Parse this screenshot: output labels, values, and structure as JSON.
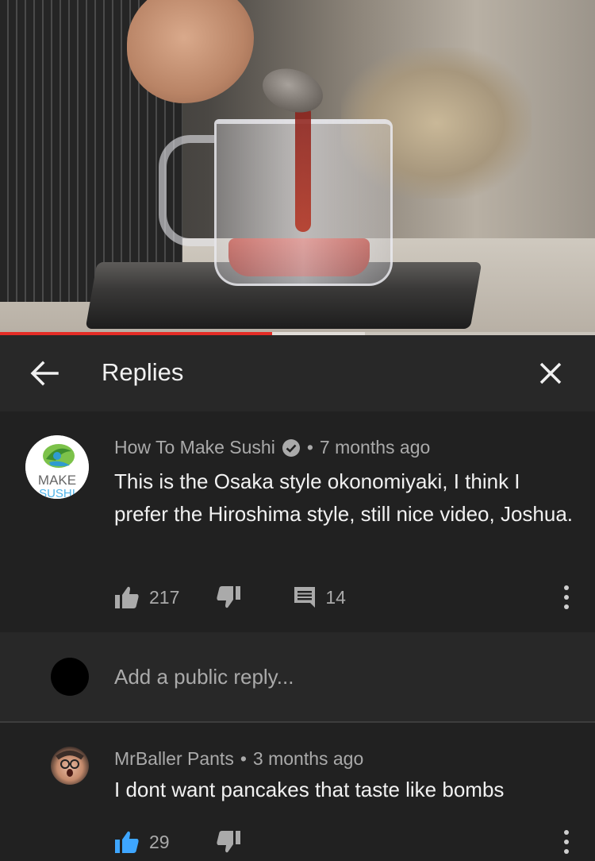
{
  "video": {
    "progress_fraction": 0.457,
    "buffered_fraction": 0.613,
    "progress_color": "#e52d27"
  },
  "header": {
    "title": "Replies",
    "back_icon": "arrow-left-icon",
    "close_icon": "close-icon"
  },
  "main_comment": {
    "author": "How To Make Sushi",
    "verified_icon": "verified-check-icon",
    "separator": "•",
    "time": "7 months ago",
    "text": "This is the Osaka style okonomiyaki, I think I prefer the Hiroshima style, still nice video, Joshua.",
    "likes": "217",
    "replies_count": "14",
    "avatar_logo_text": "MAKE SUSHI"
  },
  "reply_box": {
    "placeholder": "Add a public reply..."
  },
  "reply_comment": {
    "author": "MrBaller Pants",
    "separator": "•",
    "time": "3 months ago",
    "text": "I dont want pancakes that taste like bombs",
    "likes": "29",
    "liked_color": "#3ea6ff"
  }
}
